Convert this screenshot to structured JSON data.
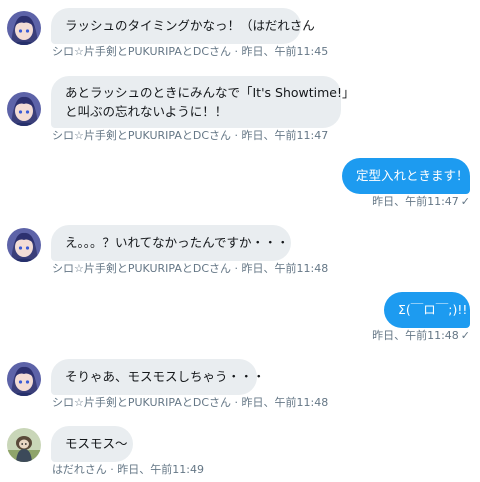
{
  "thread": {
    "messages": [
      {
        "direction": "incoming",
        "text": "ラッシュのタイミングかなっ！（はだれさん",
        "sender": "シロ☆片手剣とPUKURIPAとDCさん",
        "time": "昨日、午前11:45",
        "avatar": "anime-avatar-icon"
      },
      {
        "direction": "incoming",
        "lines": [
          "あとラッシュのときにみんなで「It's Showtime!」",
          "と叫ぶの忘れないように！！"
        ],
        "sender": "シロ☆片手剣とPUKURIPAとDCさん",
        "time": "昨日、午前11:47",
        "avatar": "anime-avatar-icon"
      },
      {
        "direction": "outgoing",
        "text": "定型入れときます！",
        "time": "昨日、午前11:47",
        "status": "✓"
      },
      {
        "direction": "incoming",
        "text": "え。。。？いれてなかったんですか・・・",
        "sender": "シロ☆片手剣とPUKURIPAとDCさん",
        "time": "昨日、午前11:48",
        "avatar": "anime-avatar-icon"
      },
      {
        "direction": "outgoing",
        "text": "Σ(￣ロ￣;)!!",
        "time": "昨日、午前11:48",
        "status": "✓"
      },
      {
        "direction": "incoming",
        "text": "そりゃあ、モスモスしちゃう・・・",
        "sender": "シロ☆片手剣とPUKURIPAとDCさん",
        "time": "昨日、午前11:48",
        "avatar": "anime-avatar-icon"
      },
      {
        "direction": "incoming",
        "text": "モスモス〜",
        "sender": "はだれさん",
        "time": "昨日、午前11:49",
        "avatar": "character-avatar-icon"
      }
    ],
    "separator": " · "
  },
  "colors": {
    "incoming_bubble": "#e9edf0",
    "outgoing_bubble": "#1d9bf0",
    "meta_text": "#657786"
  }
}
